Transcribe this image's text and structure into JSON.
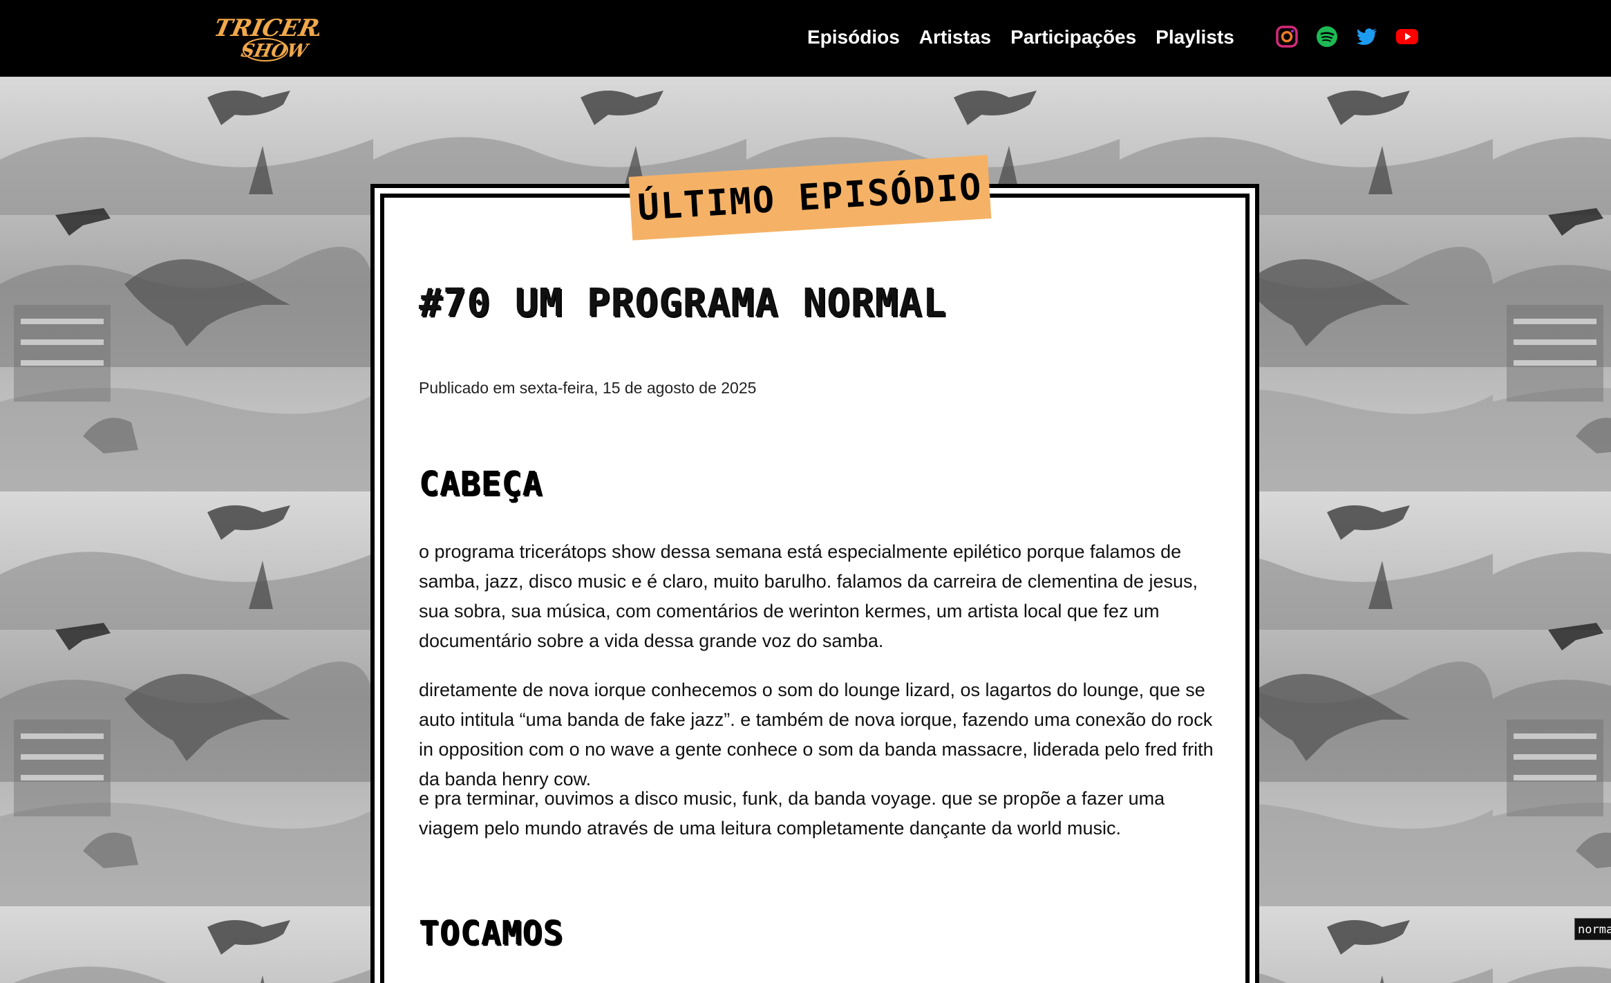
{
  "header": {
    "nav": {
      "episodios": "Episódios",
      "artistas": "Artistas",
      "participacoes": "Participações",
      "playlists": "Playlists"
    },
    "socials": [
      "instagram-icon",
      "spotify-icon",
      "twitter-icon",
      "youtube-icon"
    ]
  },
  "latest": {
    "ribbon": "ÚLTIMO EPISÓDIO",
    "title": "#70 UM PROGRAMA NORMAL",
    "published": "Publicado em sexta-feira, 15 de agosto de 2025",
    "section1_heading": "CABEÇA",
    "paragraphs": [
      "o programa tricerátops show dessa semana está especialmente epilético porque falamos de samba, jazz, disco music e é claro, muito barulho. falamos da carreira de clementina de jesus, sua sobra, sua música, com comentários de werinton kermes, um artista local que fez um documentário sobre a vida dessa grande voz do samba.",
      "diretamente de nova iorque conhecemos o som do lounge lizard, os lagartos do lounge, que se auto intitula “uma banda de fake jazz”. e também de nova iorque, fazendo uma conexão do rock in opposition com o no wave a gente conhece o som da banda massacre, liderada pelo fred frith da banda henry cow.",
      "e pra terminar, ouvimos a disco music, funk, da banda voyage. que se propõe a fazer uma viagem pelo mundo através de uma leitura completamente dançante da world music."
    ],
    "section2_heading": "TOCAMOS"
  },
  "corner_tag": "norma",
  "colors": {
    "topbar": "#000000",
    "ribbon": "#f5b266",
    "logo": "#f0a84a",
    "instagram": "#d6297a",
    "spotify": "#1db954",
    "twitter": "#1d9bf0",
    "youtube": "#ff0000"
  }
}
